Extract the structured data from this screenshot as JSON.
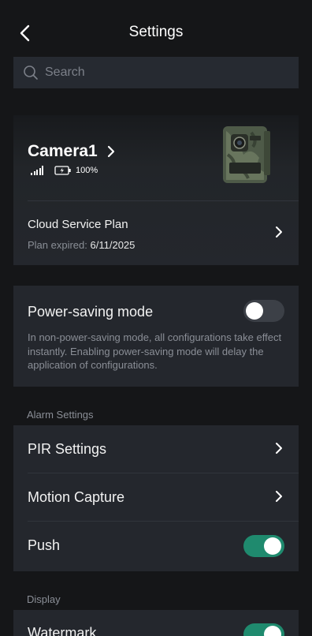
{
  "header": {
    "title": "Settings"
  },
  "search": {
    "placeholder": "Search"
  },
  "camera": {
    "name": "Camera1",
    "battery_percent": "100%",
    "signal_bars": 4,
    "plan_label": "Cloud Service Plan",
    "plan_expired_prefix": "Plan expired:",
    "plan_expired_date": "6/11/2025"
  },
  "power_saving": {
    "title": "Power-saving mode",
    "description": "In non-power-saving mode, all configurations take effect instantly. Enabling power-saving mode will delay the application of configurations.",
    "enabled": false
  },
  "alarm_settings": {
    "section_label": "Alarm Settings",
    "items": [
      {
        "label": "PIR Settings"
      },
      {
        "label": "Motion Capture"
      },
      {
        "label": "Push",
        "enabled": true
      }
    ]
  },
  "display": {
    "section_label": "Display",
    "items": [
      {
        "label": "Watermark",
        "enabled": true
      }
    ]
  },
  "colors": {
    "background": "#151618",
    "card": "#24272d",
    "accent_toggle_on": "#1f8a6e",
    "toggle_off": "#3c4047",
    "muted_text": "#8a8e96"
  }
}
